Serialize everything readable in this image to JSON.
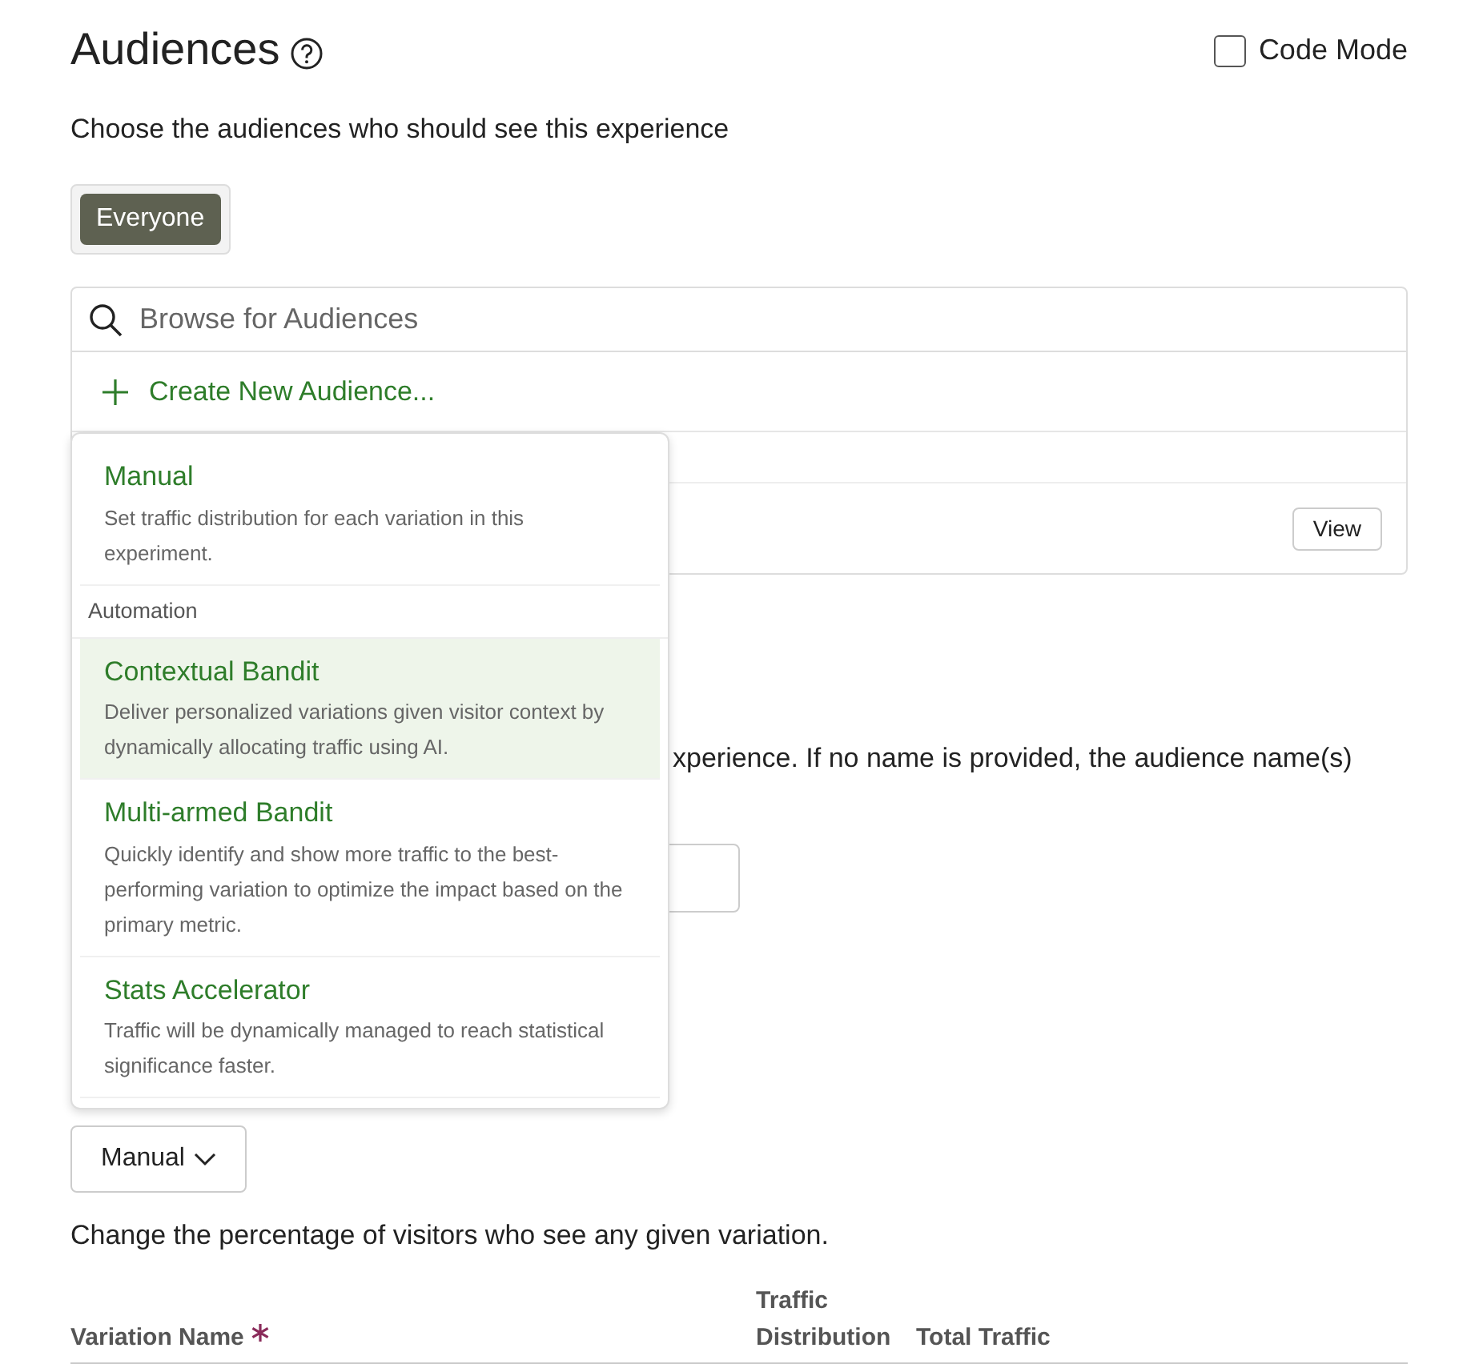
{
  "header": {
    "title": "Audiences",
    "code_mode": {
      "label": "Code Mode",
      "checked": false
    }
  },
  "description": "Choose the audiences who should see this experience",
  "selected_audiences": [
    {
      "label": "Everyone"
    }
  ],
  "audience_browser": {
    "search": {
      "placeholder": "Browse for Audiences"
    },
    "create_link": "Create New Audience...",
    "rows": [
      {
        "button": ""
      },
      {
        "button": "View"
      }
    ]
  },
  "name_hint_fragment": "xperience. If no name is provided, the audience name(s)",
  "distribution": {
    "button": "Manual",
    "description": "Change the percentage of visitors who see any given variation.",
    "columns": [
      {
        "label": "Variation Name",
        "required": true
      },
      {
        "label": "Traffic Distribution",
        "required": false
      },
      {
        "label": "Total Traffic",
        "required": false
      }
    ]
  },
  "dropdown": {
    "items": [
      {
        "kind": "option",
        "title": "Manual",
        "description": "Set traffic distribution for each variation in this experiment.",
        "selected": false
      },
      {
        "kind": "header",
        "label": "Automation"
      },
      {
        "kind": "option",
        "title": "Contextual Bandit",
        "description": "Deliver personalized variations given visitor context by dynamically allocating traffic using AI.",
        "selected": true
      },
      {
        "kind": "option",
        "title": "Multi-armed Bandit",
        "description": "Quickly identify and show more traffic to the best-performing variation to optimize the impact based on the primary metric.",
        "selected": false
      },
      {
        "kind": "option",
        "title": "Stats Accelerator",
        "description": "Traffic will be dynamically managed to reach statistical significance faster.",
        "selected": false
      }
    ]
  }
}
